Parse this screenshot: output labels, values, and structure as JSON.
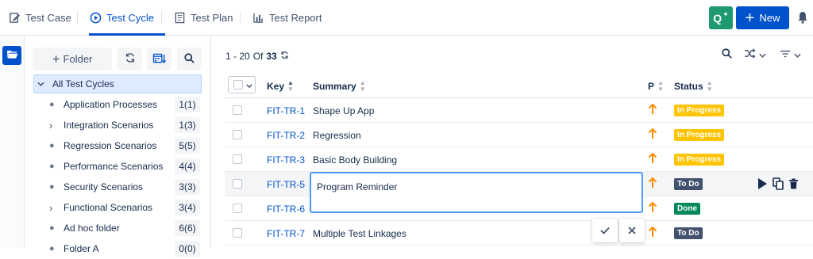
{
  "tabs": [
    {
      "label": "Test Case",
      "icon": "edit-doc-icon",
      "active": false
    },
    {
      "label": "Test Cycle",
      "icon": "play-circle-icon",
      "active": true
    },
    {
      "label": "Test Plan",
      "icon": "document-icon",
      "active": false
    },
    {
      "label": "Test Report",
      "icon": "bar-chart-icon",
      "active": false
    }
  ],
  "header": {
    "qa_label": "Q",
    "new_label": "New"
  },
  "sidebar": {
    "add_folder_label": "Folder",
    "root_label": "All Test Cycles",
    "items": [
      {
        "label": "Application Processes",
        "count": "1(1)",
        "expandable": false
      },
      {
        "label": "Integration Scenarios",
        "count": "1(3)",
        "expandable": true
      },
      {
        "label": "Regression Scenarios",
        "count": "5(5)",
        "expandable": false
      },
      {
        "label": "Performance Scenarios",
        "count": "4(4)",
        "expandable": false
      },
      {
        "label": "Security Scenarios",
        "count": "3(3)",
        "expandable": false
      },
      {
        "label": "Functional Scenarios",
        "count": "3(4)",
        "expandable": true
      },
      {
        "label": "Ad hoc folder",
        "count": "6(6)",
        "expandable": false
      },
      {
        "label": "Folder A",
        "count": "0(0)",
        "expandable": false
      }
    ]
  },
  "pager": {
    "range": "1 - 20",
    "of_label": "Of",
    "total": "33"
  },
  "table": {
    "columns": {
      "key": "Key",
      "summary": "Summary",
      "priority": "P",
      "status": "Status"
    },
    "rows": [
      {
        "key": "FIT-TR-1",
        "summary": "Shape Up App",
        "status": "In Progress",
        "status_color": "#ffc400"
      },
      {
        "key": "FIT-TR-2",
        "summary": "Regression",
        "status": "In Progress",
        "status_color": "#ffc400"
      },
      {
        "key": "FIT-TR-3",
        "summary": "Basic Body Building",
        "status": "In Progress",
        "status_color": "#ffc400"
      },
      {
        "key": "FIT-TR-5",
        "summary": "",
        "status": "To Do",
        "status_color": "#42526e"
      },
      {
        "key": "FIT-TR-6",
        "summary": "",
        "status": "Done",
        "status_color": "#00875a"
      },
      {
        "key": "FIT-TR-7",
        "summary": "Multiple Test Linkages",
        "status": "To Do",
        "status_color": "#42526e"
      }
    ]
  },
  "editor": {
    "value": "Program Reminder"
  },
  "colors": {
    "accent": "#0052cc",
    "priority": "#ff8b00",
    "qa": "#1f9a6e"
  }
}
